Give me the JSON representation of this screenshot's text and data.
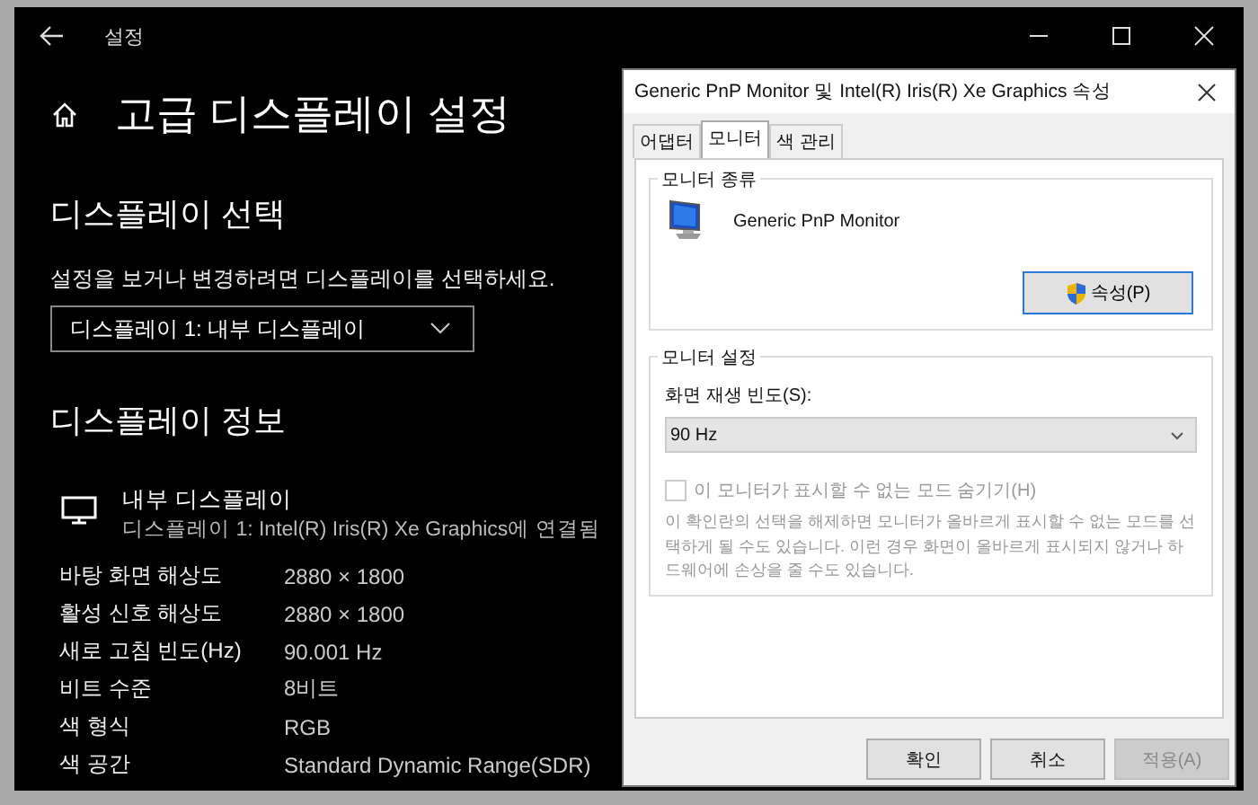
{
  "settings": {
    "title": "설정",
    "heading": "고급 디스플레이 설정",
    "select_section": {
      "title": "디스플레이 선택",
      "hint": "설정을 보거나 변경하려면 디스플레이를 선택하세요.",
      "dropdown": "디스플레이 1: 내부 디스플레이"
    },
    "info_section": {
      "title": "디스플레이 정보",
      "display_name": "내부 디스플레이",
      "display_connection": "디스플레이 1: Intel(R) Iris(R) Xe Graphics에 연결됨",
      "rows": [
        {
          "label": "바탕 화면 해상도",
          "value": "2880 × 1800"
        },
        {
          "label": "활성 신호 해상도",
          "value": "2880 × 1800"
        },
        {
          "label": "새로 고침 빈도(Hz)",
          "value": "90.001 Hz"
        },
        {
          "label": "비트 수준",
          "value": "8비트"
        },
        {
          "label": "색 형식",
          "value": "RGB"
        },
        {
          "label": "색 공간",
          "value": "Standard Dynamic Range(SDR)"
        }
      ]
    }
  },
  "dialog": {
    "title": "Generic PnP Monitor 및 Intel(R) Iris(R) Xe Graphics 속성",
    "tabs": [
      {
        "label": "어댑터",
        "selected": false
      },
      {
        "label": "모니터",
        "selected": true
      },
      {
        "label": "색 관리",
        "selected": false
      }
    ],
    "monitor_type": {
      "legend": "모니터 종류",
      "monitor_name": "Generic PnP Monitor",
      "properties_button": "속성(P)"
    },
    "monitor_settings": {
      "legend": "모니터 설정",
      "refresh_label": "화면 재생 빈도(S):",
      "refresh_value": "90 Hz",
      "hide_modes": {
        "label": "이 모니터가 표시할 수 없는 모드 숨기기(H)",
        "checked": false,
        "disabled": true
      },
      "warning": "이 확인란의 선택을 해제하면 모니터가 올바르게 표시할 수 없는 모드를 선택하게 될 수도 있습니다. 이런 경우 화면이 올바르게 표시되지 않거나 하드웨어에 손상을 줄 수도 있습니다."
    },
    "buttons": [
      {
        "label": "확인",
        "disabled": false
      },
      {
        "label": "취소",
        "disabled": false
      },
      {
        "label": "적용(A)",
        "disabled": true
      }
    ]
  }
}
